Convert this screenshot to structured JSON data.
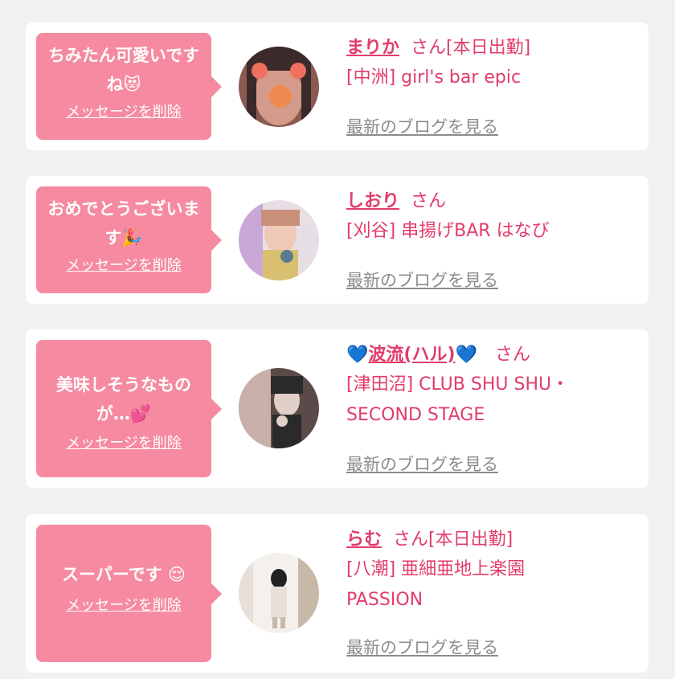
{
  "messages": [
    {
      "bubble_text": "ちみたん可愛いですね😻",
      "delete_label": "メッセージを削除",
      "name": "まりか",
      "honorific": "さん",
      "status": "[本日出勤]",
      "shop": "[中洲] girl's bar epic",
      "blog_label": "最新のブログを見る",
      "avatar_colors": [
        "#3b2a2a",
        "#d49a8a",
        "#f07060",
        "#8a5a50"
      ]
    },
    {
      "bubble_text": "おめでとうございます🎉",
      "delete_label": "メッセージを削除",
      "name": "しおり",
      "honorific": "さん",
      "status": "",
      "shop": "[刈谷] 串揚げBAR はなび",
      "blog_label": "最新のブログを見る",
      "avatar_colors": [
        "#e8dfe6",
        "#f0c8b8",
        "#c9a8d8",
        "#d8c070"
      ]
    },
    {
      "bubble_text": "美味しそうなものが…💕",
      "delete_label": "メッセージを削除",
      "name_prefix_icon": "💙",
      "name": "波流(ハル)",
      "name_suffix_icon": "💙",
      "honorific": "さん",
      "status": "",
      "shop": "[津田沼] CLUB SHU SHU・SECOND STAGE",
      "blog_label": "最新のブログを見る",
      "avatar_colors": [
        "#5a4a48",
        "#c8b0a8",
        "#2a2a2a",
        "#e0d0c8"
      ]
    },
    {
      "bubble_text": "スーパーです 😌",
      "delete_label": "メッセージを削除",
      "name": "らむ",
      "honorific": "さん",
      "status": "[本日出勤]",
      "shop": "[八潮] 亜細亜地上楽園 PASSION",
      "blog_label": "最新のブログを見る",
      "avatar_colors": [
        "#f4f0ec",
        "#222222",
        "#e8e0d8",
        "#c8b8a8"
      ]
    }
  ],
  "colors": {
    "background": "#f1f1f1",
    "card": "#ffffff",
    "bubble": "#f58aa0",
    "accent": "#e23c6a",
    "link_gray": "#8c8c8c",
    "heart_blue": "#1e7ee8"
  }
}
